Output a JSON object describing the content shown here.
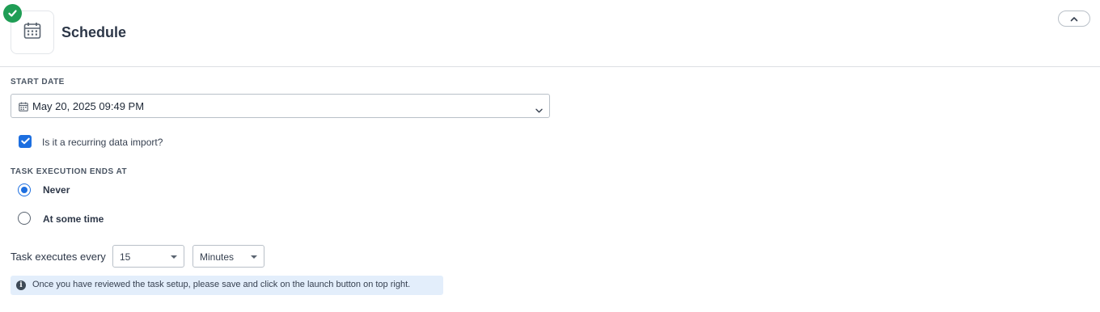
{
  "header": {
    "title": "Schedule",
    "status_icon": "check-circle-icon",
    "tile_icon": "calendar-icon",
    "collapse_icon": "chevron-up-icon",
    "status_color": "#1f9d55"
  },
  "start_date": {
    "label": "START DATE",
    "value": "May 20, 2025 09:49 PM"
  },
  "recurring": {
    "label": "Is it a recurring data import?",
    "checked": true
  },
  "ends_at": {
    "label": "TASK EXECUTION ENDS AT",
    "options": [
      {
        "label": "Never",
        "selected": true
      },
      {
        "label": "At some time",
        "selected": false
      }
    ]
  },
  "frequency": {
    "label": "Task executes every",
    "interval_value": "15",
    "unit_value": "Minutes"
  },
  "info": {
    "text": "Once you have reviewed the task setup, please save and click on the launch button on top right.",
    "icon": "info-icon"
  },
  "colors": {
    "accent": "#1d6fe0",
    "info_bg": "#e3eefb"
  }
}
